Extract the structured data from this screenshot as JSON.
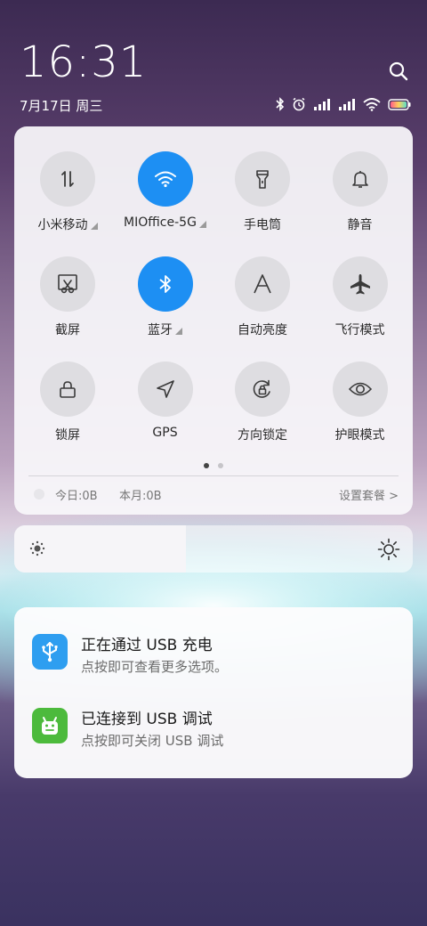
{
  "status_bar": {
    "time": "16:31",
    "date": "7月17日 周三"
  },
  "quick_settings": {
    "tiles": [
      {
        "label": "小米移动",
        "icon": "data-transfer-icon",
        "active": false,
        "has_more": true
      },
      {
        "label": "MIOffice-5G",
        "icon": "wifi-icon",
        "active": true,
        "has_more": true
      },
      {
        "label": "手电筒",
        "icon": "flashlight-icon",
        "active": false,
        "has_more": false
      },
      {
        "label": "静音",
        "icon": "bell-icon",
        "active": false,
        "has_more": false
      },
      {
        "label": "截屏",
        "icon": "screenshot-icon",
        "active": false,
        "has_more": false
      },
      {
        "label": "蓝牙",
        "icon": "bluetooth-icon",
        "active": true,
        "has_more": true
      },
      {
        "label": "自动亮度",
        "icon": "auto-brightness-icon",
        "active": false,
        "has_more": false
      },
      {
        "label": "飞行模式",
        "icon": "airplane-icon",
        "active": false,
        "has_more": false
      },
      {
        "label": "锁屏",
        "icon": "lock-icon",
        "active": false,
        "has_more": false
      },
      {
        "label": "GPS",
        "icon": "location-arrow-icon",
        "active": false,
        "has_more": false
      },
      {
        "label": "方向锁定",
        "icon": "rotation-lock-icon",
        "active": false,
        "has_more": false
      },
      {
        "label": "护眼模式",
        "icon": "eye-icon",
        "active": false,
        "has_more": false
      }
    ],
    "page_count": 2,
    "current_page": 1,
    "data_usage": {
      "today": "今日:0B",
      "month": "本月:0B",
      "plan_link": "设置套餐 >"
    }
  },
  "brightness": {
    "level": 0.43
  },
  "notifications": [
    {
      "title": "正在通过 USB 充电",
      "text": "点按即可查看更多选项。",
      "icon": "usb-icon",
      "icon_color": "#2e9ef0"
    },
    {
      "title": "已连接到 USB 调试",
      "text": "点按即可关闭 USB 调试",
      "icon": "android-debug-icon",
      "icon_color": "#4cba3c"
    }
  ],
  "colors": {
    "active_tile": "#1d8ff3",
    "inactive_tile": "#dedde1"
  }
}
